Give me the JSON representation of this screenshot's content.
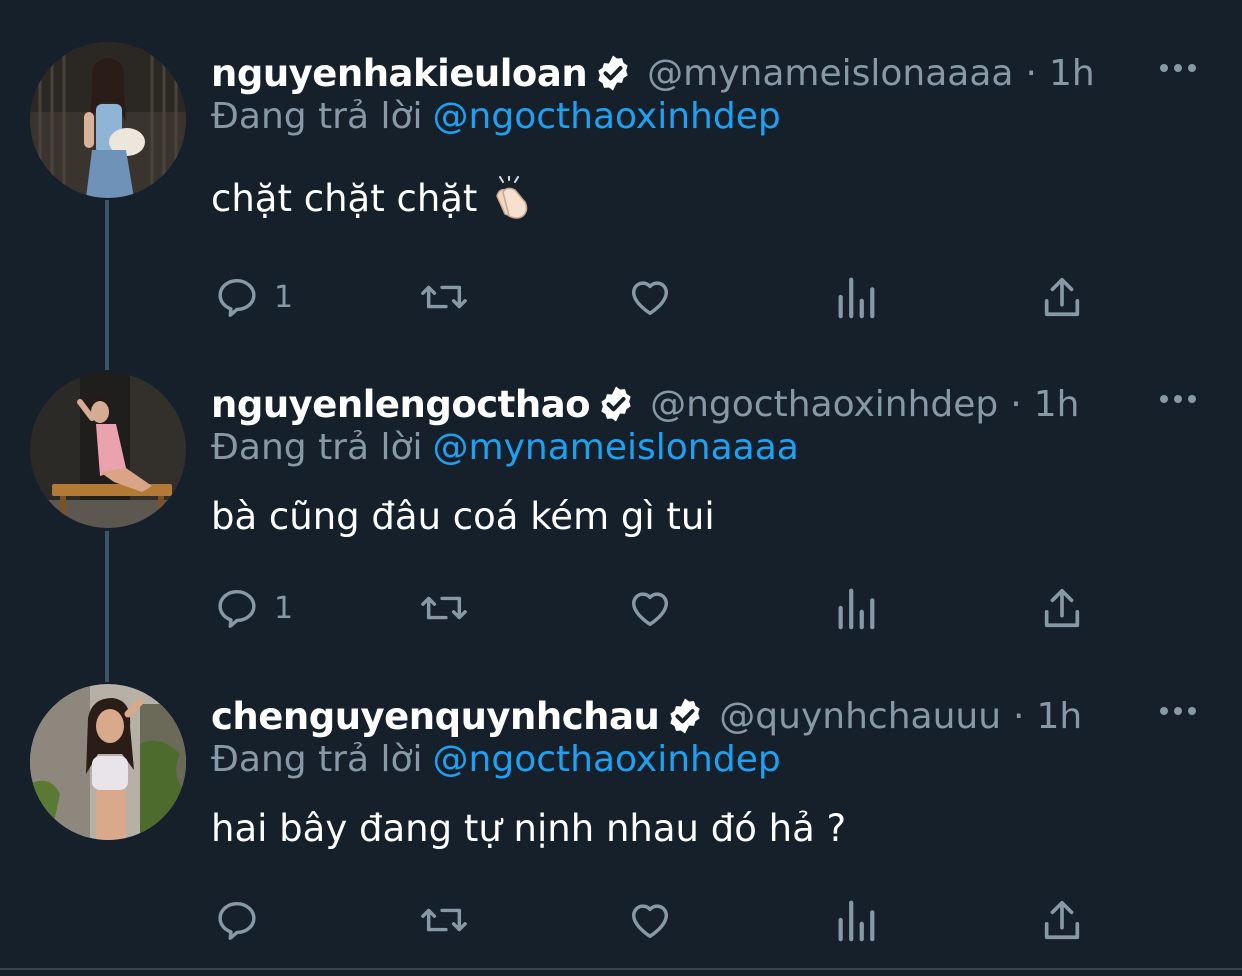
{
  "colors": {
    "background": "#15202b",
    "primary_text": "#ffffff",
    "secondary_text": "#8899a6",
    "mention": "#1da1f2",
    "thread_line": "#3d5466"
  },
  "icons": {
    "verified": "verified-badge-icon",
    "more": "more-options-icon",
    "reply": "reply-icon",
    "retweet": "retweet-icon",
    "like": "like-icon",
    "analytics": "analytics-icon",
    "share": "share-icon",
    "emoji": "clapping-hands-emoji"
  },
  "reply_prefix": "Đang trả lời",
  "tweets": [
    {
      "name": "nguyenhakieuloan",
      "handle": "@mynameislonaaaa",
      "separator": "·",
      "time": "1h",
      "reply_to": "@ngocthaoxinhdep",
      "text": "chặt chặt chặt",
      "reply_count": "1"
    },
    {
      "name": "nguyenlengocthao",
      "handle": "@ngocthaoxinhdep",
      "separator": "·",
      "time": "1h",
      "reply_to": "@mynameislonaaaa",
      "text": "bà cũng đâu coá kém gì tui",
      "reply_count": "1"
    },
    {
      "name": "chenguyenquynhchau",
      "handle": "@quynhchauuu",
      "separator": "·",
      "time": "1h",
      "reply_to": "@ngocthaoxinhdep",
      "text": "hai bây đang tự nịnh nhau đó hả ?",
      "reply_count": ""
    }
  ]
}
